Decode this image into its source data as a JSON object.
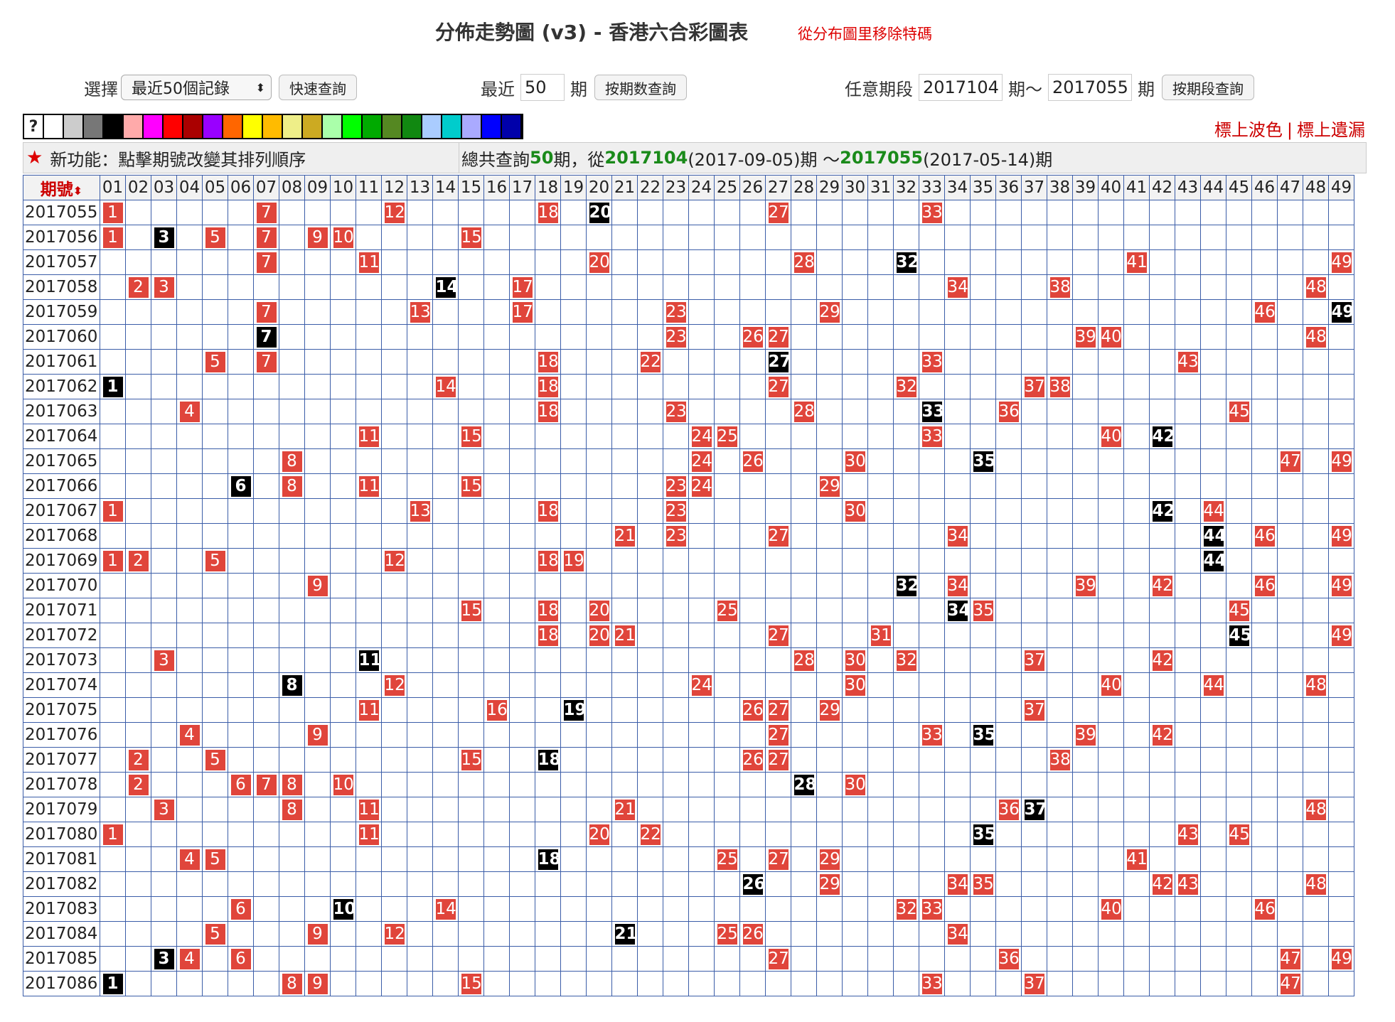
{
  "header": {
    "title": "分佈走勢圖 (v3) - 香港六合彩圖表",
    "note": "從分布圖里移除特碼"
  },
  "controls": {
    "select_label": "選擇",
    "select_value": "最近50個記錄",
    "quick_query": "快速查詢",
    "recent_label": "最近",
    "recent_value": "50",
    "period_unit": "期",
    "query_by_count": "按期数查詢",
    "range_label": "任意期段",
    "range_from": "2017104",
    "range_mid": "期～",
    "range_to": "2017055",
    "range_unit": "期",
    "query_by_range": "按期段查詢"
  },
  "swatches": {
    "question": "?",
    "colors": [
      "#ffffff",
      "#cccccc",
      "#777777",
      "#000000",
      "#ffaaaa",
      "#ff00ff",
      "#ff0000",
      "#aa0000",
      "#9900ff",
      "#ff6600",
      "#ffff00",
      "#ffbb00",
      "#eeee88",
      "#ccaa22",
      "#aaffaa",
      "#00ff00",
      "#00aa00",
      "#558822",
      "#118811",
      "#aaccff",
      "#00cccc",
      "#aaaaff",
      "#0000ff",
      "#0000aa"
    ]
  },
  "links": {
    "wave_color": "標上波色",
    "sep": "|",
    "missing": "標上遺漏"
  },
  "info": {
    "new_feature": "新功能：點擊期號改變其排列順序",
    "summary_prefix": "總共查詢",
    "summary_count": "50",
    "summary_mid": "期，從 ",
    "summary_from": "2017104",
    "summary_from_date": "(2017-09-05)期 ～",
    "summary_to": "2017055",
    "summary_to_date": "(2017-05-14)期"
  },
  "table": {
    "period_header": "期號",
    "sort_icon": "⬍",
    "columns": [
      "01",
      "02",
      "03",
      "04",
      "05",
      "06",
      "07",
      "08",
      "09",
      "10",
      "11",
      "12",
      "13",
      "14",
      "15",
      "16",
      "17",
      "18",
      "19",
      "20",
      "21",
      "22",
      "23",
      "24",
      "25",
      "26",
      "27",
      "28",
      "29",
      "30",
      "31",
      "32",
      "33",
      "34",
      "35",
      "36",
      "37",
      "38",
      "39",
      "40",
      "41",
      "42",
      "43",
      "44",
      "45",
      "46",
      "47",
      "48",
      "49"
    ],
    "rows": [
      {
        "period": "2017055",
        "reds": [
          1,
          7,
          12,
          18,
          27,
          33
        ],
        "black": 20
      },
      {
        "period": "2017056",
        "reds": [
          1,
          5,
          7,
          9,
          10,
          15
        ],
        "black": 3
      },
      {
        "period": "2017057",
        "reds": [
          7,
          11,
          20,
          28,
          41,
          49
        ],
        "black": 32
      },
      {
        "period": "2017058",
        "reds": [
          2,
          3,
          17,
          34,
          38,
          48
        ],
        "black": 14
      },
      {
        "period": "2017059",
        "reds": [
          7,
          13,
          17,
          23,
          29,
          46
        ],
        "black": 49
      },
      {
        "period": "2017060",
        "reds": [
          23,
          26,
          27,
          39,
          40,
          48
        ],
        "black": 7
      },
      {
        "period": "2017061",
        "reds": [
          5,
          7,
          18,
          22,
          33,
          43
        ],
        "black": 27
      },
      {
        "period": "2017062",
        "reds": [
          14,
          18,
          27,
          32,
          37,
          38
        ],
        "black": 1
      },
      {
        "period": "2017063",
        "reds": [
          4,
          18,
          23,
          28,
          36,
          45
        ],
        "black": 33
      },
      {
        "period": "2017064",
        "reds": [
          11,
          15,
          24,
          25,
          33,
          40
        ],
        "black": 42
      },
      {
        "period": "2017065",
        "reds": [
          8,
          24,
          26,
          30,
          47,
          49
        ],
        "black": 35
      },
      {
        "period": "2017066",
        "reds": [
          8,
          11,
          15,
          23,
          24,
          29
        ],
        "black": 6
      },
      {
        "period": "2017067",
        "reds": [
          1,
          13,
          18,
          23,
          30,
          44
        ],
        "black": 42
      },
      {
        "period": "2017068",
        "reds": [
          21,
          23,
          27,
          34,
          46,
          49
        ],
        "black": 44
      },
      {
        "period": "2017069",
        "reds": [
          1,
          2,
          5,
          12,
          18,
          19
        ],
        "black": 44
      },
      {
        "period": "2017070",
        "reds": [
          9,
          34,
          39,
          42,
          46,
          49
        ],
        "black": 32
      },
      {
        "period": "2017071",
        "reds": [
          15,
          18,
          20,
          25,
          35,
          45
        ],
        "black": 34
      },
      {
        "period": "2017072",
        "reds": [
          18,
          20,
          21,
          27,
          31,
          49
        ],
        "black": 45
      },
      {
        "period": "2017073",
        "reds": [
          3,
          28,
          30,
          32,
          37,
          42
        ],
        "black": 11
      },
      {
        "period": "2017074",
        "reds": [
          12,
          24,
          30,
          40,
          44,
          48
        ],
        "black": 8
      },
      {
        "period": "2017075",
        "reds": [
          11,
          16,
          26,
          27,
          29,
          37
        ],
        "black": 19
      },
      {
        "period": "2017076",
        "reds": [
          4,
          9,
          27,
          33,
          39,
          42
        ],
        "black": 35
      },
      {
        "period": "2017077",
        "reds": [
          2,
          5,
          15,
          26,
          27,
          38
        ],
        "black": 18
      },
      {
        "period": "2017078",
        "reds": [
          2,
          6,
          7,
          8,
          10,
          30
        ],
        "black": 28
      },
      {
        "period": "2017079",
        "reds": [
          3,
          8,
          11,
          21,
          36,
          48
        ],
        "black": 37
      },
      {
        "period": "2017080",
        "reds": [
          1,
          11,
          20,
          22,
          43,
          45
        ],
        "black": 35
      },
      {
        "period": "2017081",
        "reds": [
          4,
          5,
          25,
          27,
          29,
          41
        ],
        "black": 18
      },
      {
        "period": "2017082",
        "reds": [
          29,
          34,
          35,
          42,
          43,
          48
        ],
        "black": 26
      },
      {
        "period": "2017083",
        "reds": [
          6,
          14,
          32,
          33,
          40,
          46
        ],
        "black": 10
      },
      {
        "period": "2017084",
        "reds": [
          5,
          9,
          12,
          25,
          26,
          34
        ],
        "black": 21
      },
      {
        "period": "2017085",
        "reds": [
          4,
          6,
          27,
          36,
          47,
          49
        ],
        "black": 3
      },
      {
        "period": "2017086",
        "reds": [
          8,
          9,
          15,
          33,
          37,
          47
        ],
        "black": 1
      }
    ]
  }
}
